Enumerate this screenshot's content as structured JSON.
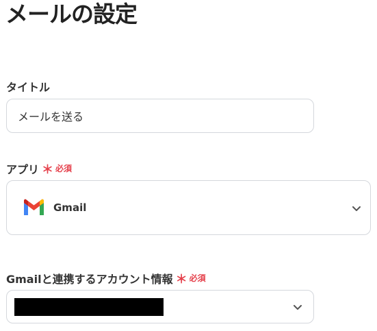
{
  "page": {
    "title": "メールの設定"
  },
  "fields": {
    "title": {
      "label": "タイトル",
      "value": "メールを送る"
    },
    "app": {
      "label": "アプリ",
      "required_mark": "＊",
      "required_text": "必須",
      "selected": "Gmail",
      "icon": "gmail-icon"
    },
    "account": {
      "label": "Gmailと連携するアカウント情報",
      "required_mark": "＊",
      "required_text": "必須",
      "selected": "",
      "redacted": true
    }
  },
  "colors": {
    "required": "#e5414c",
    "border": "#d4d7dc",
    "text": "#333333"
  }
}
